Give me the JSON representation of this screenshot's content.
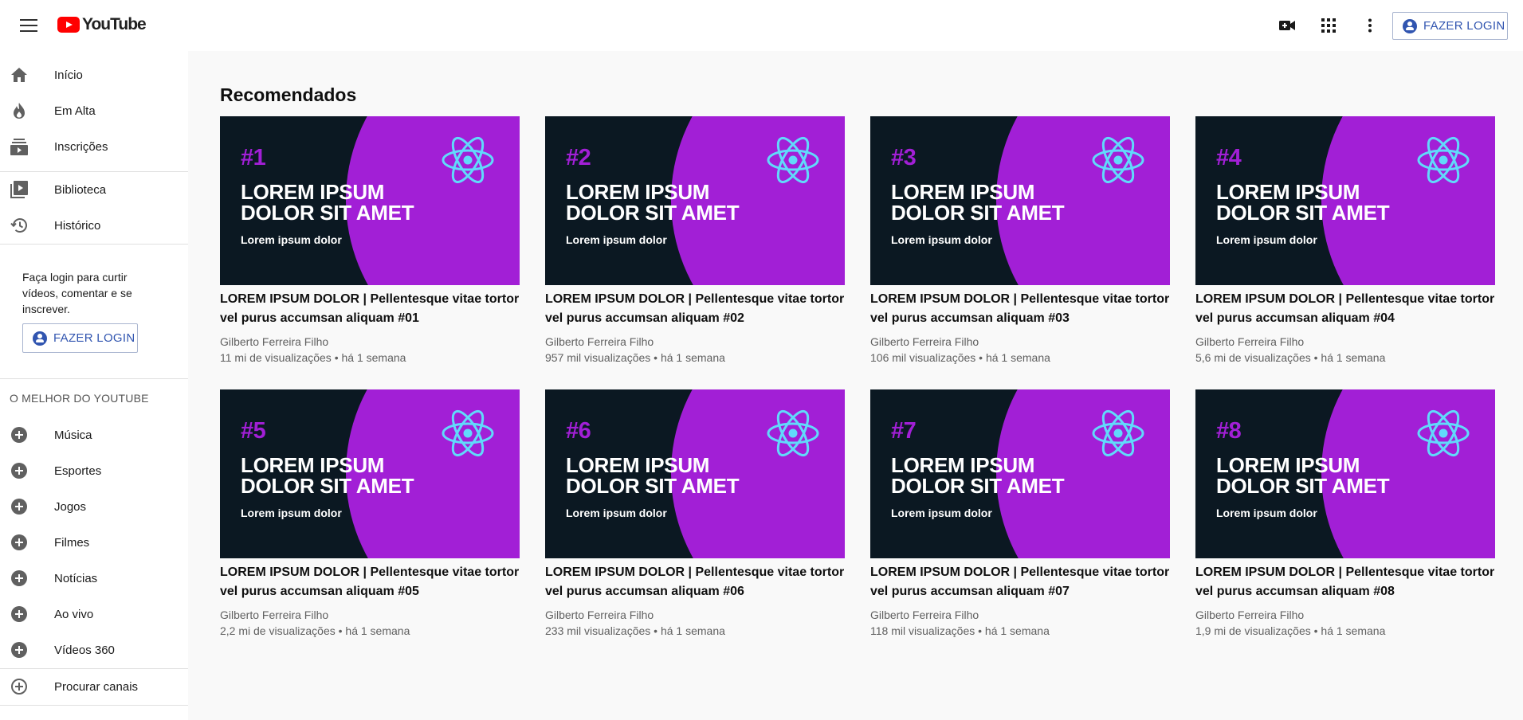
{
  "header": {
    "logo_text": "YouTube",
    "login_label": "FAZER LOGIN",
    "icons": [
      "menu-icon",
      "video-camera-icon",
      "apps-icon",
      "more-vert-icon",
      "account-icon"
    ]
  },
  "sidebar": {
    "primary": [
      {
        "label": "Início",
        "icon": "home-icon"
      },
      {
        "label": "Em Alta",
        "icon": "fire-icon"
      },
      {
        "label": "Inscrições",
        "icon": "subscriptions-icon"
      }
    ],
    "secondary": [
      {
        "label": "Biblioteca",
        "icon": "library-icon"
      },
      {
        "label": "Histórico",
        "icon": "history-icon"
      }
    ],
    "login_prompt": "Faça login para curtir vídeos, comentar e se inscrever.",
    "login_label": "FAZER LOGIN",
    "section_title": "O MELHOR DO YOUTUBE",
    "best_of": [
      {
        "label": "Música"
      },
      {
        "label": "Esportes"
      },
      {
        "label": "Jogos"
      },
      {
        "label": "Filmes"
      },
      {
        "label": "Notícias"
      },
      {
        "label": "Ao vivo"
      },
      {
        "label": "Vídeos 360"
      }
    ],
    "browse_channels": "Procurar canais"
  },
  "main": {
    "title": "Recomendados",
    "thumbnail": {
      "headline": "LOREM IPSUM DOLOR SIT AMET",
      "subline": "Lorem ipsum dolor",
      "accent": "#a21fd6",
      "background": "#0b1822",
      "icon": "react-atom-icon"
    },
    "videos": [
      {
        "number": "#1",
        "title": "LOREM IPSUM DOLOR | Pellentesque vitae tortor vel purus accumsan aliquam #01",
        "channel": "Gilberto Ferreira Filho",
        "meta": "11 mi de visualizações • há 1 semana"
      },
      {
        "number": "#2",
        "title": "LOREM IPSUM DOLOR | Pellentesque vitae tortor vel purus accumsan aliquam #02",
        "channel": "Gilberto Ferreira Filho",
        "meta": "957 mil visualizações • há 1 semana"
      },
      {
        "number": "#3",
        "title": "LOREM IPSUM DOLOR | Pellentesque vitae tortor vel purus accumsan aliquam #03",
        "channel": "Gilberto Ferreira Filho",
        "meta": "106 mil visualizações • há 1 semana"
      },
      {
        "number": "#4",
        "title": "LOREM IPSUM DOLOR | Pellentesque vitae tortor vel purus accumsan aliquam #04",
        "channel": "Gilberto Ferreira Filho",
        "meta": "5,6 mi de visualizações • há 1 semana"
      },
      {
        "number": "#5",
        "title": "LOREM IPSUM DOLOR | Pellentesque vitae tortor vel purus accumsan aliquam #05",
        "channel": "Gilberto Ferreira Filho",
        "meta": "2,2 mi de visualizações • há 1 semana"
      },
      {
        "number": "#6",
        "title": "LOREM IPSUM DOLOR | Pellentesque vitae tortor vel purus accumsan aliquam #06",
        "channel": "Gilberto Ferreira Filho",
        "meta": "233 mil visualizações • há 1 semana"
      },
      {
        "number": "#7",
        "title": "LOREM IPSUM DOLOR | Pellentesque vitae tortor vel purus accumsan aliquam #07",
        "channel": "Gilberto Ferreira Filho",
        "meta": "118 mil visualizações • há 1 semana"
      },
      {
        "number": "#8",
        "title": "LOREM IPSUM DOLOR | Pellentesque vitae tortor vel purus accumsan aliquam #08",
        "channel": "Gilberto Ferreira Filho",
        "meta": "1,9 mi de visualizações • há 1 semana"
      }
    ]
  }
}
